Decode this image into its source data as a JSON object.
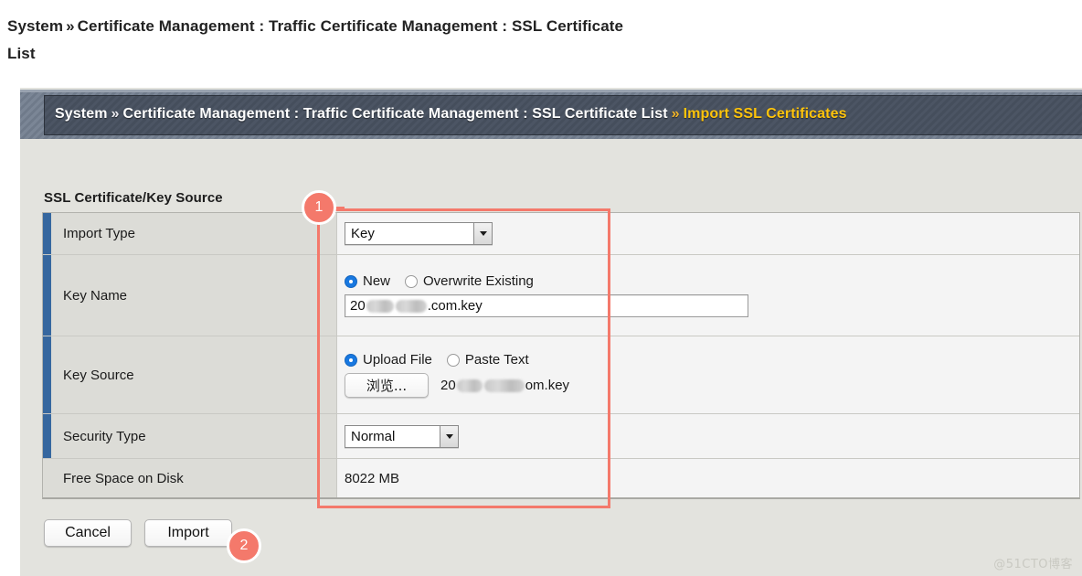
{
  "page_title": {
    "line1_prefix": "System",
    "separator": "»",
    "line1_rest": "Certificate Management : Traffic Certificate Management : SSL Certificate",
    "line2": "List"
  },
  "breadcrumb": {
    "root": "System",
    "sep1": "»",
    "path": "Certificate Management : Traffic Certificate Management : SSL Certificate List",
    "sep2": "»",
    "current": "Import SSL Certificates"
  },
  "section": {
    "heading": "SSL Certificate/Key Source"
  },
  "form": {
    "rows": [
      {
        "label": "Import Type",
        "control": "select",
        "value": "Key",
        "required": true
      },
      {
        "label": "Key Name",
        "control": "radio+text",
        "radios": [
          {
            "label": "New",
            "checked": true
          },
          {
            "label": "Overwrite Existing",
            "checked": false
          }
        ],
        "text_value_prefix": "20",
        "text_value_suffix": ".com.key",
        "required": true
      },
      {
        "label": "Key Source",
        "control": "radio+file",
        "radios": [
          {
            "label": "Upload File",
            "checked": true
          },
          {
            "label": "Paste Text",
            "checked": false
          }
        ],
        "browse_button": "浏览...",
        "file_name_prefix": "20",
        "file_name_suffix": "om.key",
        "required": true
      },
      {
        "label": "Security Type",
        "control": "select",
        "value": "Normal",
        "required": true
      },
      {
        "label": "Free Space on Disk",
        "control": "text",
        "value": "8022 MB",
        "required": false
      }
    ]
  },
  "footer": {
    "cancel_label": "Cancel",
    "import_label": "Import"
  },
  "annotations": [
    {
      "id": "1",
      "label": "1",
      "target": "form-value-column"
    },
    {
      "id": "2",
      "label": "2",
      "target": "import-button"
    }
  ],
  "colors": {
    "accent_blue": "#36679f",
    "annotation_red": "#f4796b",
    "breadcrumb_current": "#ffc40c",
    "panel_bg": "#e3e3de",
    "row_label_bg": "#dcdcd7",
    "row_value_bg": "#f4f4f4",
    "radio_selected": "#1878e0"
  },
  "watermark": "@51CTO博客"
}
